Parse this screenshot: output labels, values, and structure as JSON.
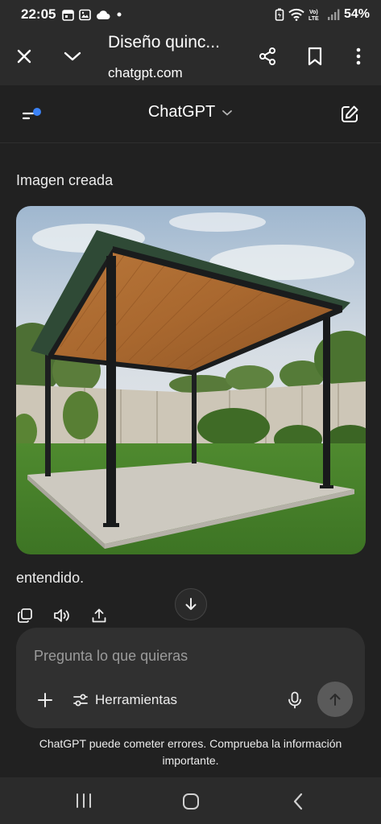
{
  "status_bar": {
    "time": "22:05",
    "battery": "54%",
    "left_icons": [
      "calendar-icon",
      "gallery-icon",
      "cloud-icon",
      "dot-icon"
    ],
    "right_icons": [
      "battery-saver-icon",
      "wifi-icon",
      "volte-lte-icon",
      "signal-icon"
    ],
    "network_label": "Vo) LTE"
  },
  "browser_tab": {
    "title": "Diseño quinc...",
    "url": "chatgpt.com"
  },
  "header": {
    "model_label": "ChatGPT"
  },
  "conversation": {
    "image_caption": "Imagen creada",
    "image_alt": "pergola",
    "reply_text": "entendido."
  },
  "composer": {
    "placeholder": "Pregunta lo que quieras",
    "tools_label": "Herramientas"
  },
  "disclaimer": "ChatGPT puede cometer errores. Comprueba la información importante.",
  "colors": {
    "background": "#212121",
    "bars": "#2b2b2b",
    "composer": "#303030",
    "accent_dot": "#3b82f6",
    "send_button": "#5a5a5a"
  }
}
